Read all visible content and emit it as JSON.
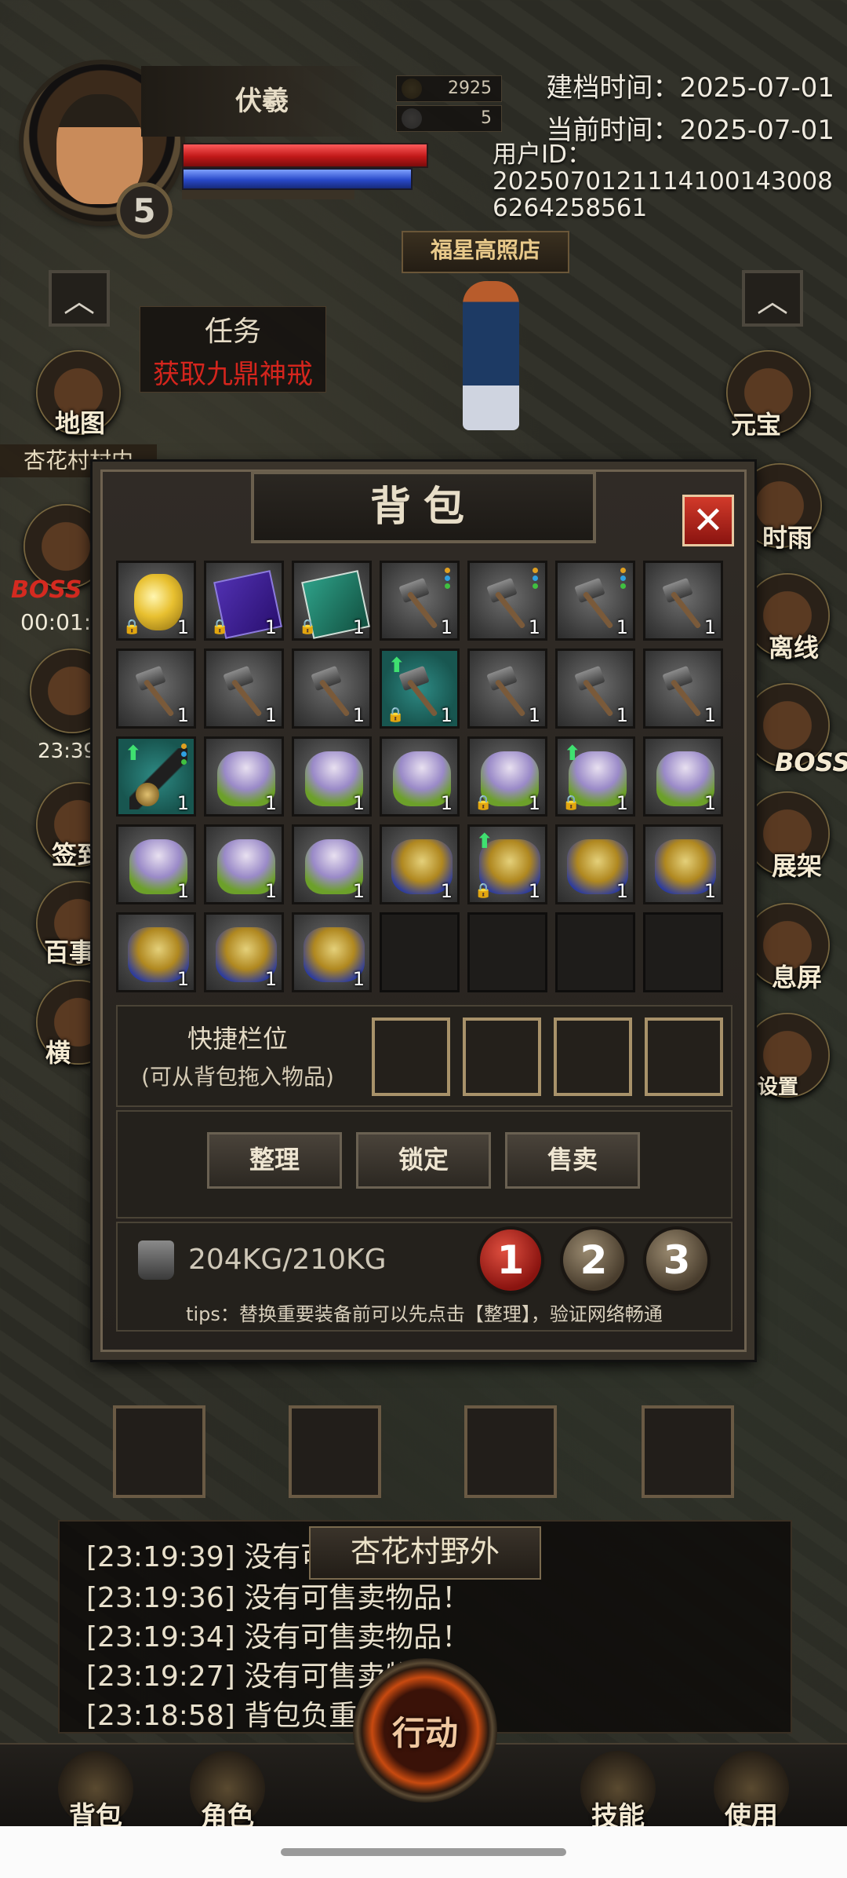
{
  "player": {
    "name": "伏羲",
    "level": "5",
    "coins": "2925",
    "gems": "5"
  },
  "info": {
    "created": "建档时间：2025-07-01",
    "current": "当前时间：2025-07-01",
    "user_id_label": "用户ID：",
    "user_id": "20250701211141001430086264258561"
  },
  "world": {
    "shop_sign": "福星高照店",
    "location": "杏花村野外",
    "village_label": "杏花村村内"
  },
  "quest": {
    "title": "任务",
    "desc": "获取九鼎神戒"
  },
  "left_menu": [
    {
      "label": "地图"
    },
    {
      "label": "BOSS",
      "timer": "00:01:"
    },
    {
      "label": "",
      "timer": "23:39"
    },
    {
      "label": "签到"
    },
    {
      "label": "百事"
    },
    {
      "label": "横"
    }
  ],
  "right_menu": [
    {
      "label": "元宝"
    },
    {
      "label": "时雨"
    },
    {
      "label": "离线"
    },
    {
      "label": "BOSS"
    },
    {
      "label": "展架"
    },
    {
      "label": "息屏"
    },
    {
      "label": "设置"
    }
  ],
  "inventory": {
    "title": "背包",
    "quick_label": "快捷栏位",
    "quick_sub": "(可从背包拖入物品)",
    "buttons": {
      "sort": "整理",
      "lock": "锁定",
      "sell": "售卖"
    },
    "weight": "204KG/210KG",
    "pages": [
      "1",
      "2",
      "3"
    ],
    "active_page": "1",
    "tips": "tips：替换重要装备前可以先点击【整理】，验证网络畅通",
    "items": [
      {
        "kind": "bag",
        "qty": "1",
        "lock": true
      },
      {
        "kind": "book-blue",
        "qty": "1",
        "lock": true
      },
      {
        "kind": "book-teal",
        "qty": "1",
        "lock": true
      },
      {
        "kind": "hammer",
        "qty": "1",
        "dots": true
      },
      {
        "kind": "hammer",
        "qty": "1",
        "dots": true
      },
      {
        "kind": "hammer",
        "qty": "1",
        "dots": true
      },
      {
        "kind": "hammer",
        "qty": "1"
      },
      {
        "kind": "hammer",
        "qty": "1"
      },
      {
        "kind": "hammer",
        "qty": "1"
      },
      {
        "kind": "hammer",
        "qty": "1"
      },
      {
        "kind": "hammer-teal",
        "qty": "1",
        "lock": true,
        "up": true
      },
      {
        "kind": "hammer",
        "qty": "1"
      },
      {
        "kind": "hammer",
        "qty": "1"
      },
      {
        "kind": "hammer",
        "qty": "1"
      },
      {
        "kind": "staff",
        "qty": "1",
        "up": true,
        "dots": true
      },
      {
        "kind": "armor-purple",
        "qty": "1"
      },
      {
        "kind": "armor-purple",
        "qty": "1"
      },
      {
        "kind": "armor-purple",
        "qty": "1"
      },
      {
        "kind": "armor-purple",
        "qty": "1",
        "lock": true
      },
      {
        "kind": "armor-purple",
        "qty": "1",
        "up": true,
        "lock": true
      },
      {
        "kind": "armor-purple",
        "qty": "1"
      },
      {
        "kind": "armor-purple",
        "qty": "1"
      },
      {
        "kind": "armor-purple",
        "qty": "1"
      },
      {
        "kind": "armor-purple",
        "qty": "1"
      },
      {
        "kind": "armor-gold",
        "qty": "1"
      },
      {
        "kind": "armor-gold",
        "qty": "1",
        "up": true,
        "lock": true
      },
      {
        "kind": "armor-gold",
        "qty": "1"
      },
      {
        "kind": "armor-gold",
        "qty": "1"
      },
      {
        "kind": "armor-gold",
        "qty": "1"
      },
      {
        "kind": "armor-gold",
        "qty": "1"
      },
      {
        "kind": "armor-gold",
        "qty": "1"
      },
      {
        "kind": "empty"
      },
      {
        "kind": "empty"
      },
      {
        "kind": "empty"
      },
      {
        "kind": "empty"
      }
    ]
  },
  "chat": [
    "[23:19:39] 没有可售卖物品！",
    "[23:19:36] 没有可售卖物品！",
    "[23:19:34] 没有可售卖物品！",
    "[23:19:27] 没有可售卖物品！",
    "[23:18:58] 背包负重不足"
  ],
  "bottom_bar": {
    "bag": "背包",
    "role": "角色",
    "action": "行动",
    "skill": "技能",
    "use": "使用"
  },
  "colors": {
    "accent_red": "#d23a2a",
    "quest_red": "#d4251d",
    "frame": "#6e6250"
  }
}
